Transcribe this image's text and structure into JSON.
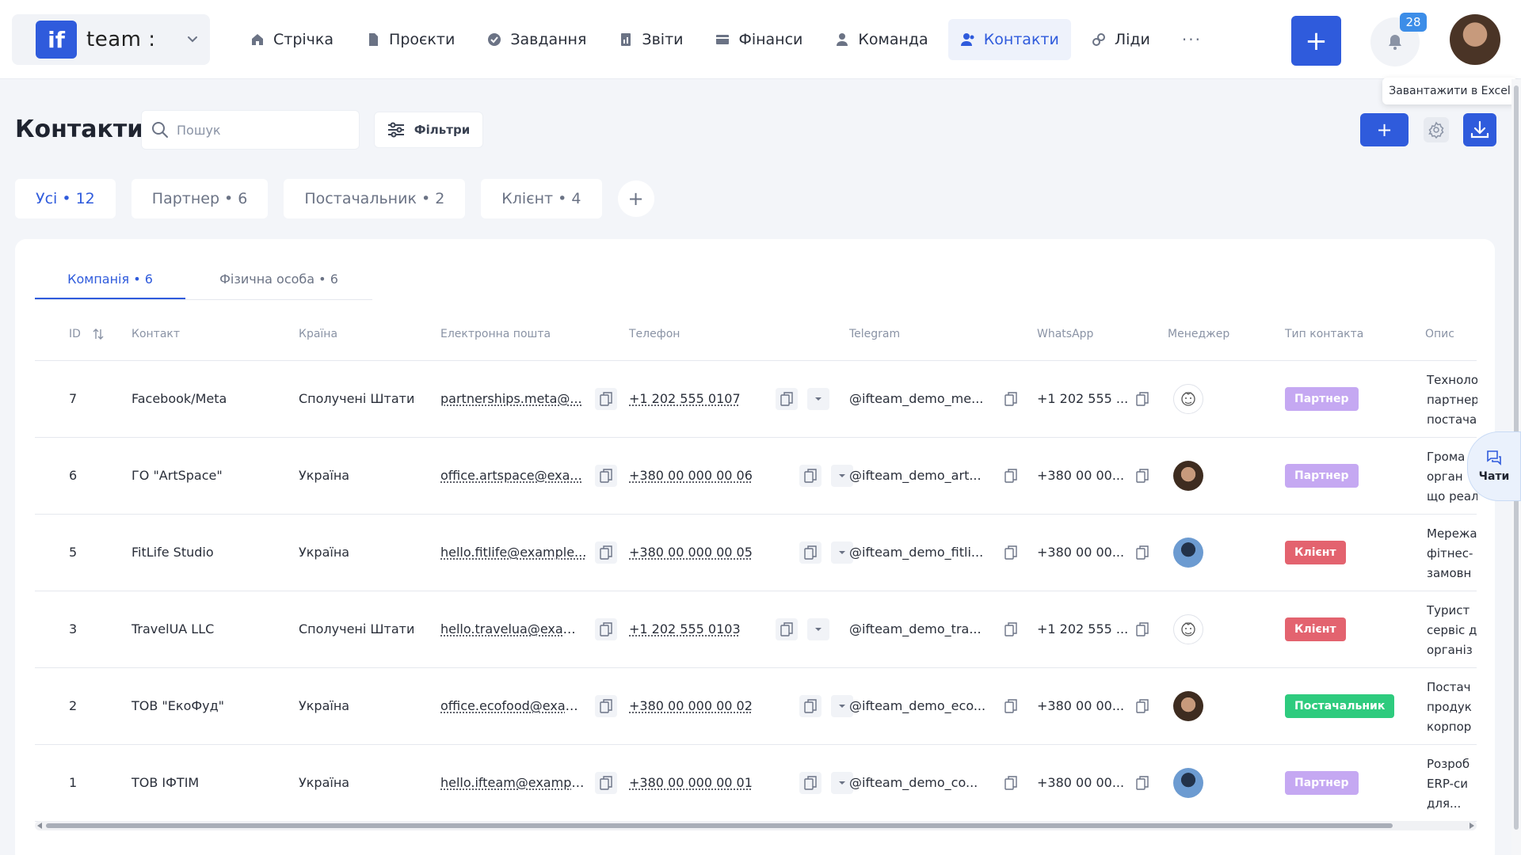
{
  "brand": {
    "logo": "if",
    "name": "team :"
  },
  "nav": [
    {
      "label": "Стрічка",
      "icon": "home-icon"
    },
    {
      "label": "Проєкти",
      "icon": "document-icon"
    },
    {
      "label": "Завдання",
      "icon": "check-circle-icon"
    },
    {
      "label": "Звіти",
      "icon": "chart-icon"
    },
    {
      "label": "Фінанси",
      "icon": "wallet-icon"
    },
    {
      "label": "Команда",
      "icon": "person-icon"
    },
    {
      "label": "Контакти",
      "icon": "people-icon",
      "active": true
    },
    {
      "label": "Ліди",
      "icon": "link-icon"
    }
  ],
  "nav_more": "···",
  "header": {
    "add": "+",
    "notifications": "28"
  },
  "page": {
    "title": "Контакти",
    "search_placeholder": "Пошук",
    "filters": "Фільтри",
    "add": "+",
    "tooltip": "Завантажити в Excel"
  },
  "segments": [
    {
      "label": "Усі • 12",
      "active": true
    },
    {
      "label": "Партнер • 6"
    },
    {
      "label": "Постачальник • 2"
    },
    {
      "label": "Клієнт • 4"
    }
  ],
  "segment_add": "+",
  "subtabs": [
    {
      "label": "Компанія • 6",
      "active": true
    },
    {
      "label": "Фізична особа • 6"
    }
  ],
  "columns": [
    "ID",
    "Контакт",
    "Країна",
    "Електронна пошта",
    "Телефон",
    "Telegram",
    "WhatsApp",
    "Менеджер",
    "Тип контакта",
    "Опис"
  ],
  "rows": [
    {
      "id": "7",
      "contact": "Facebook/Meta",
      "country": "Сполучені Штати",
      "email": "partnerships.meta@...",
      "phone": "+1 202 555 0107",
      "telegram": "@ifteam_demo_me...",
      "whatsapp": "+1 202 555 ...",
      "manager": "m1",
      "type": "Партнер",
      "type_kind": "partner",
      "desc": [
        "Техноло",
        "партнер",
        "постача"
      ]
    },
    {
      "id": "6",
      "contact": "ГО \"ArtSpace\"",
      "country": "Україна",
      "email": "office.artspace@exa...",
      "phone": "+380 00 000 00 06",
      "telegram": "@ifteam_demo_art...",
      "whatsapp": "+380 00 00...",
      "manager": "m2",
      "type": "Партнер",
      "type_kind": "partner",
      "desc": [
        "Грома",
        "орган",
        "що реал"
      ]
    },
    {
      "id": "5",
      "contact": "FitLife Studio",
      "country": "Україна",
      "email": "hello.fitlife@example...",
      "phone": "+380 00 000 00 05",
      "telegram": "@ifteam_demo_fitli...",
      "whatsapp": "+380 00 00...",
      "manager": "m3",
      "type": "Клієнт",
      "type_kind": "client",
      "desc": [
        "Мережа",
        "фітнес-",
        "замовн"
      ]
    },
    {
      "id": "3",
      "contact": "TravelUA LLC",
      "country": "Сполучені Штати",
      "email": "hello.travelua@exam...",
      "phone": "+1 202 555 0103",
      "telegram": "@ifteam_demo_tra...",
      "whatsapp": "+1 202 555 ...",
      "manager": "m1",
      "type": "Клієнт",
      "type_kind": "client",
      "desc": [
        "Турист",
        "сервіс д",
        "організ"
      ]
    },
    {
      "id": "2",
      "contact": "ТОВ \"ЕкоФуд\"",
      "country": "Україна",
      "email": "office.ecofood@exam...",
      "phone": "+380 00 000 00 02",
      "telegram": "@ifteam_demo_eco...",
      "whatsapp": "+380 00 00...",
      "manager": "m2",
      "type": "Постачальник",
      "type_kind": "supplier",
      "desc": [
        "Постач",
        "продук",
        "корпор"
      ]
    },
    {
      "id": "1",
      "contact": "ТОВ ІФТІМ",
      "country": "Україна",
      "email": "hello.ifteam@exampl...",
      "phone": "+380 00 000 00 01",
      "telegram": "@ifteam_demo_co...",
      "whatsapp": "+380 00 00...",
      "manager": "m3",
      "type": "Партнер",
      "type_kind": "partner",
      "desc": [
        "Розроб",
        "ERP-си",
        "для..."
      ]
    }
  ],
  "chat": "Чати"
}
